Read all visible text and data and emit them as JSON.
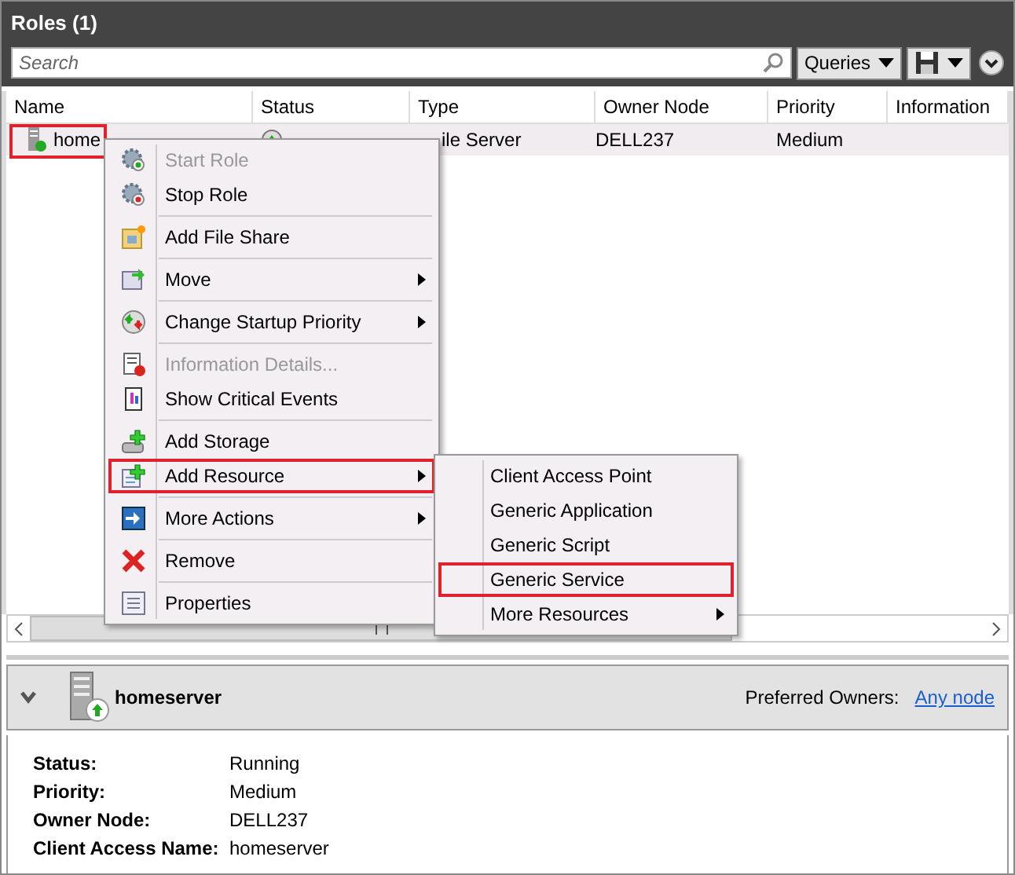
{
  "panel": {
    "title": "Roles (1)"
  },
  "search": {
    "placeholder": "Search"
  },
  "queries_button": "Queries",
  "columns": [
    "Name",
    "Status",
    "Type",
    "Owner Node",
    "Priority",
    "Information"
  ],
  "row": {
    "name": "home",
    "type": "ile Server",
    "owner_node": "DELL237",
    "priority": "Medium",
    "selected": true
  },
  "context_menu_groups": [
    [
      {
        "label": "Start Role",
        "kind": "start",
        "disabled": true,
        "submenu": false,
        "selected": false
      },
      {
        "label": "Stop Role",
        "kind": "stop",
        "disabled": false,
        "submenu": false,
        "selected": false
      }
    ],
    [
      {
        "label": "Add File Share",
        "kind": "share",
        "disabled": false,
        "submenu": false,
        "selected": false
      }
    ],
    [
      {
        "label": "Move",
        "kind": "move",
        "disabled": false,
        "submenu": true,
        "selected": false
      }
    ],
    [
      {
        "label": "Change Startup Priority",
        "kind": "priority",
        "disabled": false,
        "submenu": true,
        "selected": false
      }
    ],
    [
      {
        "label": "Information Details...",
        "kind": "info",
        "disabled": true,
        "submenu": false,
        "selected": false
      },
      {
        "label": "Show Critical Events",
        "kind": "events",
        "disabled": false,
        "submenu": false,
        "selected": false
      }
    ],
    [
      {
        "label": "Add Storage",
        "kind": "storage",
        "disabled": false,
        "submenu": false,
        "selected": false
      },
      {
        "label": "Add Resource",
        "kind": "resource",
        "disabled": false,
        "submenu": true,
        "selected": true
      }
    ],
    [
      {
        "label": "More Actions",
        "kind": "more",
        "disabled": false,
        "submenu": true,
        "selected": false
      }
    ],
    [
      {
        "label": "Remove",
        "kind": "remove",
        "disabled": false,
        "submenu": false,
        "selected": false
      }
    ],
    [
      {
        "label": "Properties",
        "kind": "properties",
        "disabled": false,
        "submenu": false,
        "selected": false
      }
    ]
  ],
  "submenu": [
    {
      "label": "Client Access Point",
      "submenu": false,
      "selected": false
    },
    {
      "label": "Generic Application",
      "submenu": false,
      "selected": false
    },
    {
      "label": "Generic Script",
      "submenu": false,
      "selected": false
    },
    {
      "label": "Generic Service",
      "submenu": false,
      "selected": true
    },
    {
      "label": "More Resources",
      "submenu": true,
      "selected": false
    }
  ],
  "details": {
    "title": "homeserver",
    "preferred_owners_label": "Preferred Owners:",
    "preferred_owners_link": "Any node",
    "fields": [
      {
        "label": "Status:",
        "value": "Running"
      },
      {
        "label": "Priority:",
        "value": "Medium"
      },
      {
        "label": "Owner Node:",
        "value": "DELL237"
      },
      {
        "label": "Client Access Name:",
        "value": "homeserver"
      }
    ]
  }
}
